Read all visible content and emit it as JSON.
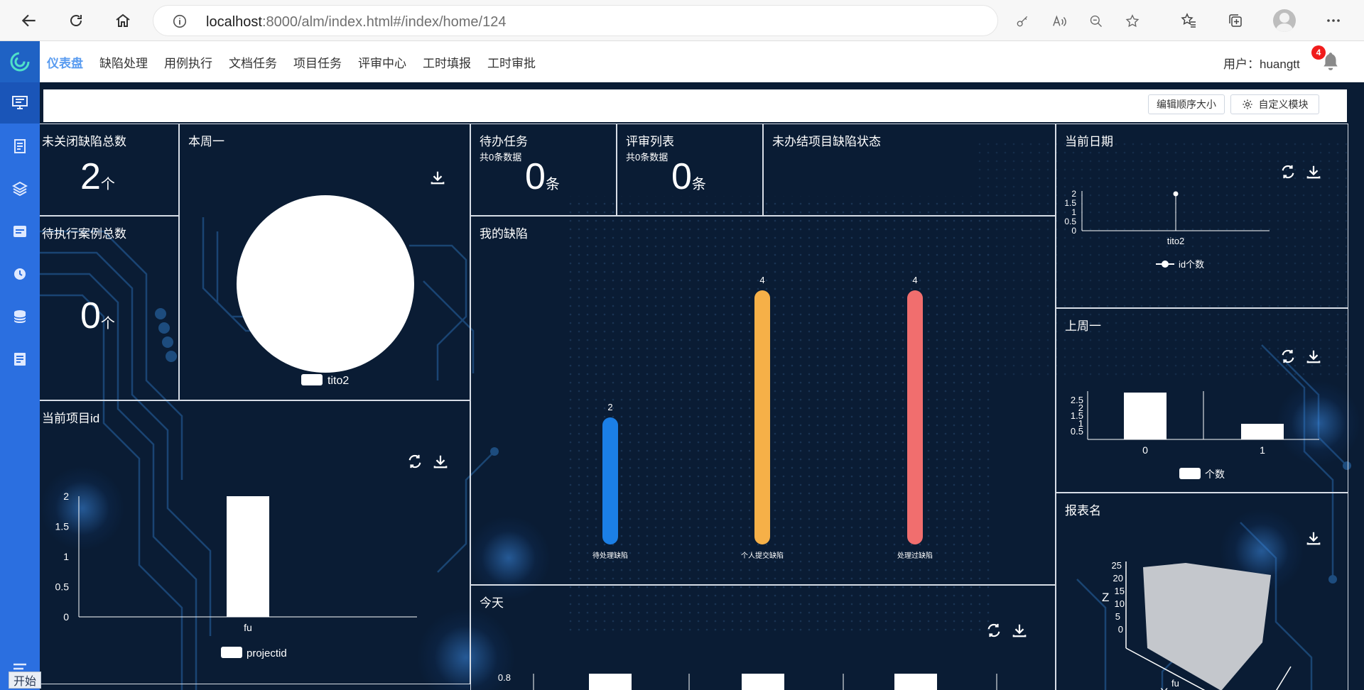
{
  "browser": {
    "url_host": "localhost",
    "url_rest": ":8000/alm/index.html#/index/home/124"
  },
  "nav": {
    "items": [
      "仪表盘",
      "缺陷处理",
      "用例执行",
      "文档任务",
      "项目任务",
      "评审中心",
      "工时填报",
      "工时审批"
    ],
    "user_label": "用户：huangtt",
    "notification_count": "4"
  },
  "toolbar": {
    "edit_order_label": "编辑顺序大小",
    "custom_module_label": "自定义模块"
  },
  "panels": {
    "unclosed_defects": {
      "title": "未关闭缺陷总数",
      "value": "2",
      "unit": "个"
    },
    "pending_cases": {
      "title": "待执行案例总数",
      "value": "0",
      "unit": "个"
    },
    "this_monday": {
      "title": "本周一",
      "legend": "tito2"
    },
    "todo_tasks": {
      "title": "待办任务",
      "sub": "共0条数据",
      "value": "0",
      "unit": "条"
    },
    "review_list": {
      "title": "评审列表",
      "sub": "共0条数据",
      "value": "0",
      "unit": "条"
    },
    "unfinished_defect_status": {
      "title": "未办结项目缺陷状态"
    },
    "current_date": {
      "title": "当前日期"
    },
    "my_defects": {
      "title": "我的缺陷"
    },
    "current_project": {
      "title": "当前项目id"
    },
    "last_monday": {
      "title": "上周一"
    },
    "today": {
      "title": "今天"
    },
    "report_name": {
      "title": "报表名"
    }
  },
  "chart_data": [
    {
      "name": "本周一",
      "type": "pie",
      "labels": [
        "tito2"
      ],
      "values": [
        1
      ],
      "legend": [
        "tito2"
      ]
    },
    {
      "name": "当前日期",
      "type": "scatter",
      "x": [
        "tito2"
      ],
      "series": [
        {
          "name": "id个数",
          "values": [
            2
          ]
        }
      ],
      "yticks": [
        "0",
        "0.5",
        "1",
        "1.5",
        "2"
      ],
      "ylim": [
        0,
        2
      ]
    },
    {
      "name": "我的缺陷",
      "type": "bar",
      "categories": [
        "待处理缺陷",
        "个人提交缺陷",
        "处理过缺陷"
      ],
      "values": [
        2,
        4,
        4
      ],
      "colors": [
        "#1b7fe6",
        "#f6b048",
        "#f16e6e"
      ],
      "ylim": [
        0,
        4
      ]
    },
    {
      "name": "当前项目id",
      "type": "bar",
      "categories": [
        "fu"
      ],
      "series": [
        {
          "name": "projectid",
          "values": [
            2
          ]
        }
      ],
      "yticks": [
        "0",
        "0.5",
        "1",
        "1.5",
        "2"
      ],
      "ylim": [
        0,
        2
      ]
    },
    {
      "name": "上周一",
      "type": "bar",
      "categories": [
        "0",
        "1"
      ],
      "series": [
        {
          "name": "个数",
          "values": [
            3,
            1
          ]
        }
      ],
      "yticks": [
        "0.5",
        "1",
        "1.5",
        "2",
        "2.5"
      ],
      "ylim": [
        0,
        3
      ]
    },
    {
      "name": "今天",
      "type": "bar",
      "yticks": [
        "0.8"
      ]
    },
    {
      "name": "报表名",
      "type": "area",
      "axis_labels": {
        "x": "X",
        "z": "Z"
      },
      "x_tick": "fu",
      "z_ticks": [
        "0",
        "5",
        "10",
        "15",
        "20",
        "25"
      ]
    }
  ],
  "footer": {
    "start_label": "开始"
  }
}
